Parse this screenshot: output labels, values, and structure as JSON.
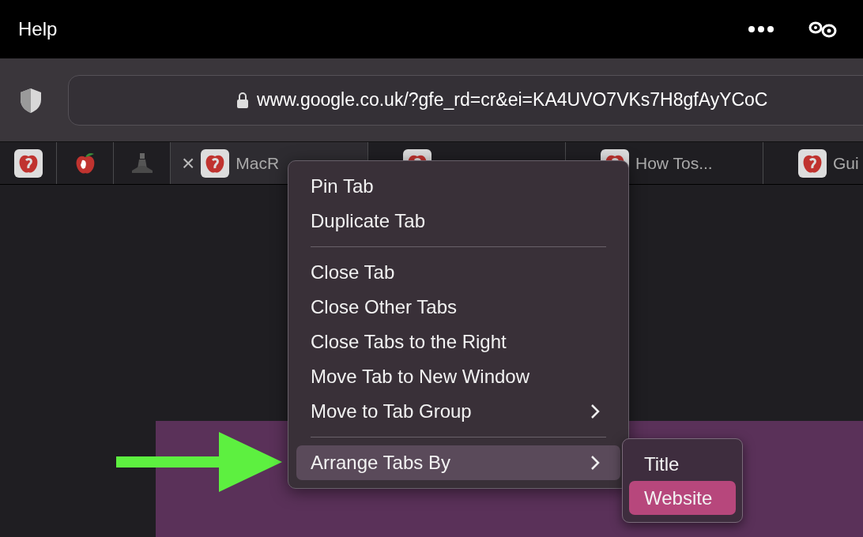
{
  "menu_bar": {
    "title": "Help"
  },
  "address_bar": {
    "url": "www.google.co.uk/?gfe_rd=cr&ei=KA4UVO7VKs7H8gfAyYCoC"
  },
  "tabs": [
    {
      "kind": "pinned",
      "selected": false
    },
    {
      "kind": "pinned",
      "selected": false
    },
    {
      "kind": "pinned",
      "selected": false
    },
    {
      "kind": "page",
      "label": "MacR",
      "close": "×",
      "selected": true
    },
    {
      "kind": "page",
      "selected": false
    },
    {
      "kind": "page",
      "label": "How Tos...",
      "selected": false
    },
    {
      "kind": "page",
      "label": "Gui",
      "selected": false
    }
  ],
  "context_menu": {
    "items": [
      {
        "kind": "item",
        "label": "Pin Tab",
        "selected": false
      },
      {
        "kind": "item",
        "label": "Duplicate Tab",
        "selected": false
      },
      {
        "kind": "separator"
      },
      {
        "kind": "item",
        "label": "Close Tab",
        "selected": false
      },
      {
        "kind": "item",
        "label": "Close Other Tabs",
        "selected": false
      },
      {
        "kind": "item",
        "label": "Close Tabs to the Right",
        "selected": false
      },
      {
        "kind": "item",
        "label": "Move Tab to New Window",
        "selected": false
      },
      {
        "kind": "submenu",
        "label": "Move to Tab Group",
        "selected": false
      },
      {
        "kind": "separator"
      },
      {
        "kind": "submenu",
        "label": "Arrange Tabs By",
        "selected": true
      }
    ]
  },
  "submenu": {
    "items": [
      {
        "label": "Title",
        "selected": false
      },
      {
        "label": "Website",
        "selected": true
      }
    ]
  }
}
